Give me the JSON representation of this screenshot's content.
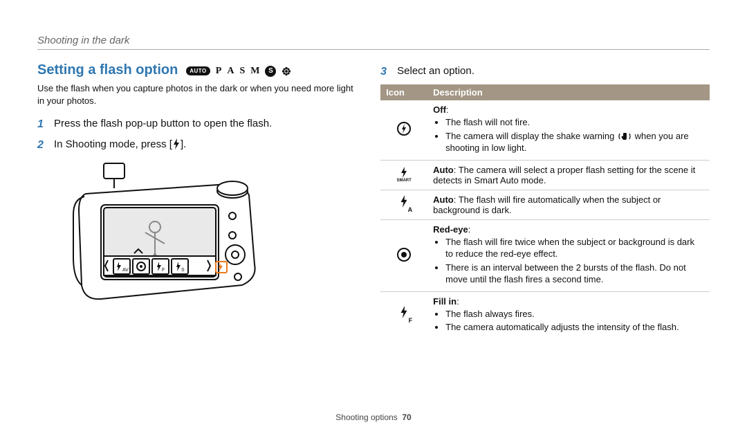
{
  "breadcrumb": "Shooting in the dark",
  "section_title": "Setting a flash option",
  "modes": {
    "auto": "AUTO",
    "p": "P",
    "a": "A",
    "s": "S",
    "m": "M",
    "s_disc": "S"
  },
  "intro": "Use the flash when you capture photos in the dark or when you need more light in your photos.",
  "steps": {
    "s1_num": "1",
    "s1": "Press the flash pop-up button to open the flash.",
    "s2_num": "2",
    "s2_pre": "In Shooting mode, press [",
    "s2_post": "].",
    "s3_num": "3",
    "s3": "Select an option."
  },
  "table": {
    "head_icon": "Icon",
    "head_desc": "Description",
    "rows": {
      "off": {
        "title": "Off",
        "b1": "The flash will not fire.",
        "b2_pre": "The camera will display the shake warning ",
        "b2_post": " when you are shooting in low light."
      },
      "smart": {
        "title": "Auto",
        "text": ": The camera will select a proper flash setting for the scene it detects in Smart Auto mode.",
        "icon_label": "SMART"
      },
      "autoA": {
        "title": "Auto",
        "text": ": The flash will fire automatically when the subject or background is dark.",
        "sub": "A"
      },
      "redeye": {
        "title": "Red-eye",
        "b1": "The flash will fire twice when the subject or background is dark to reduce the red-eye effect.",
        "b2": "There is an interval between the 2 bursts of the flash. Do not move until the flash fires a second time."
      },
      "fillin": {
        "title": "Fill in",
        "b1": "The flash always fires.",
        "b2": "The camera automatically adjusts the intensity of the flash.",
        "sub": "F"
      }
    }
  },
  "footer": {
    "section": "Shooting options",
    "page": "70"
  }
}
